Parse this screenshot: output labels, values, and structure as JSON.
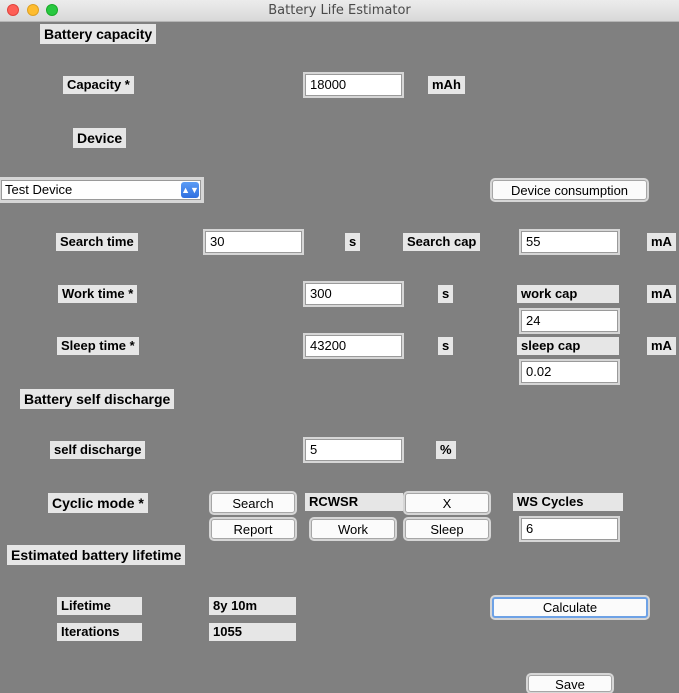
{
  "window": {
    "title": "Battery Life Estimator"
  },
  "battery": {
    "heading": "Battery capacity",
    "capacity_label": "Capacity *",
    "capacity_value": "18000",
    "capacity_unit": "mAh"
  },
  "device": {
    "heading": "Device",
    "selected": "Test Device",
    "consumption_button": "Device consumption",
    "search_time_label": "Search time",
    "search_time_value": "30",
    "search_time_unit": "s",
    "search_cap_label": "Search cap",
    "search_cap_value": "55",
    "search_cap_unit": "mA",
    "work_time_label": "Work time *",
    "work_time_value": "300",
    "work_time_unit": "s",
    "work_cap_label": "work cap",
    "work_cap_value": "24",
    "work_cap_unit": "mA",
    "sleep_time_label": "Sleep time *",
    "sleep_time_value": "43200",
    "sleep_time_unit": "s",
    "sleep_cap_label": "sleep cap",
    "sleep_cap_value": "0.02",
    "sleep_cap_unit": "mA"
  },
  "self_discharge": {
    "heading": "Battery self discharge",
    "label": "self discharge",
    "value": "5",
    "unit": "%"
  },
  "cyclic": {
    "label": "Cyclic mode *",
    "search_button": "Search",
    "report_button": "Report",
    "sequence": "RCWSR",
    "work_button": "Work",
    "x_button": "X",
    "sleep_button": "Sleep",
    "ws_cycles_label": "WS Cycles",
    "ws_cycles_value": "6"
  },
  "estimate": {
    "heading": "Estimated battery lifetime",
    "lifetime_label": "Lifetime",
    "lifetime_value": "8y 10m",
    "iterations_label": "Iterations",
    "iterations_value": "1055",
    "calculate_button": "Calculate",
    "save_button": "Save"
  }
}
